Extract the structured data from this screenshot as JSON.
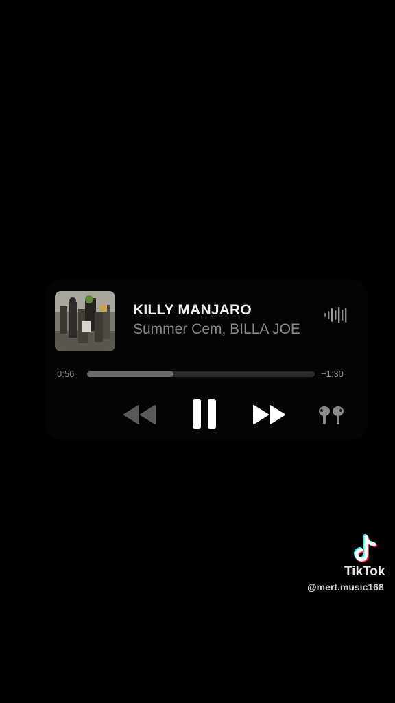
{
  "now_playing": {
    "title": "KILLY MANJARO",
    "artist": "Summer Cem, BILLA JOE",
    "elapsed": "0:56",
    "remaining": "−1:30",
    "progress_fraction": 0.38,
    "is_playing": true
  },
  "controls": {
    "rewind_icon": "rewind-icon",
    "pause_icon": "pause-icon",
    "forward_icon": "fast-forward-icon",
    "output_icon": "airpods-icon",
    "waveform_icon": "waveform-icon"
  },
  "watermark": {
    "brand": "TikTok",
    "handle": "@mert.music168"
  },
  "colors": {
    "background": "#000000",
    "title": "#f2f2f2",
    "secondary": "#8a8a8a",
    "progress_fill": "#6a6a6a",
    "progress_track": "#2a2a2a",
    "tiktok_cyan": "#25f4ee",
    "tiktok_red": "#fe2c55"
  }
}
